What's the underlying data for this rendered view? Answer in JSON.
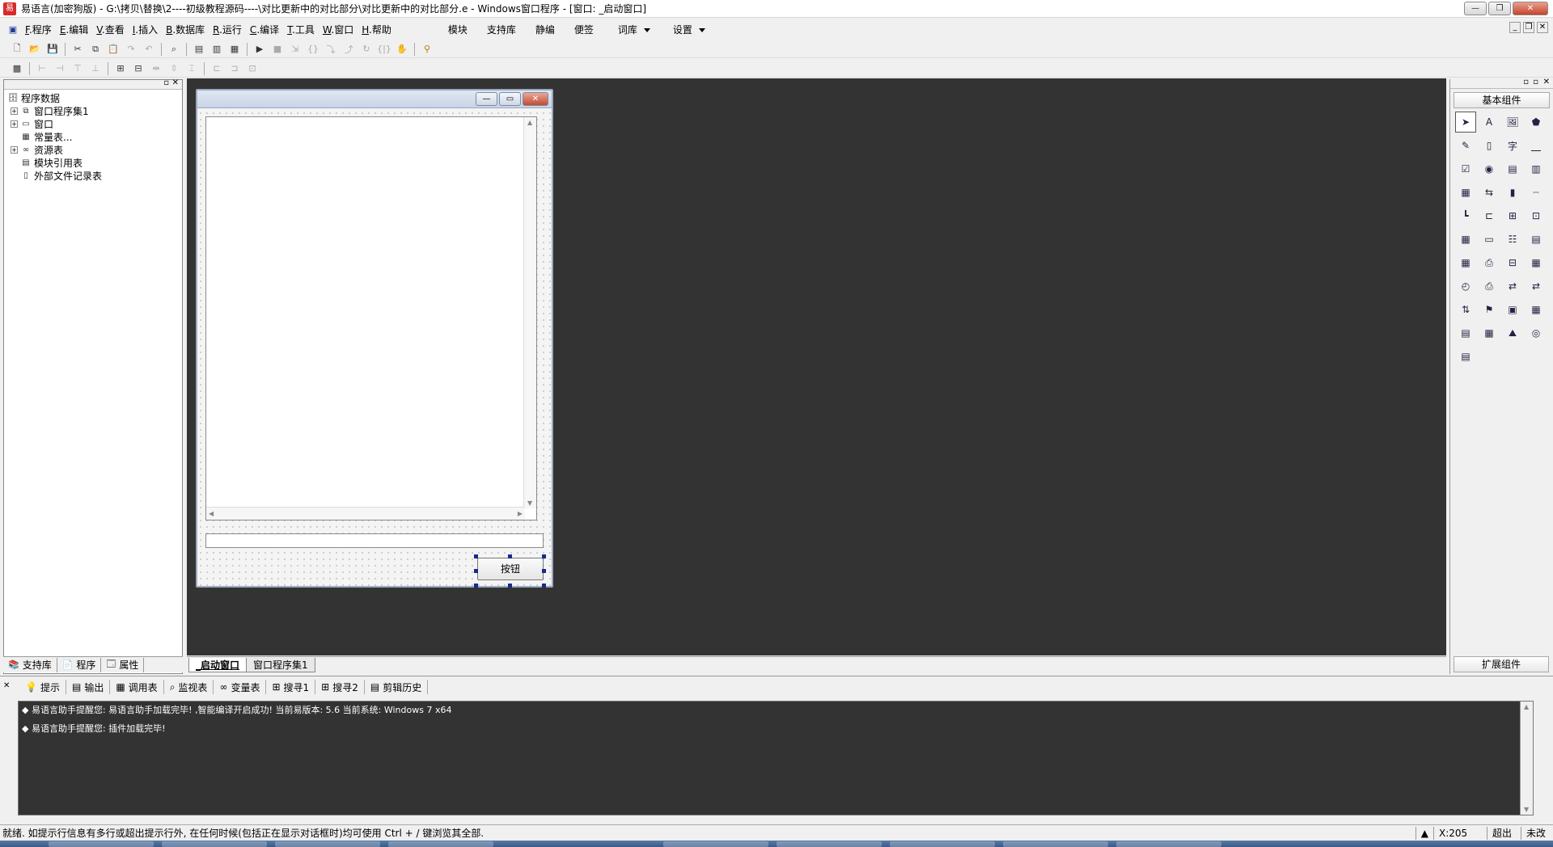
{
  "title_bar": {
    "title": "易语言(加密狗版) - G:\\拷贝\\替换\\2----初级教程源码----\\对比更新中的对比部分\\对比更新中的对比部分.e - Windows窗口程序 - [窗口: _启动窗口]",
    "minimize": "—",
    "maximize": "❐",
    "close": "✕"
  },
  "menu": {
    "items": [
      {
        "key": "F",
        "label": ".程序"
      },
      {
        "key": "E",
        "label": ".编辑"
      },
      {
        "key": "V",
        "label": ".查看"
      },
      {
        "key": "I",
        "label": ".插入"
      },
      {
        "key": "B",
        "label": ".数据库"
      },
      {
        "key": "R",
        "label": ".运行"
      },
      {
        "key": "C",
        "label": ".编译"
      },
      {
        "key": "T",
        "label": ".工具"
      },
      {
        "key": "W",
        "label": ".窗口"
      },
      {
        "key": "H",
        "label": ".帮助"
      }
    ],
    "extras": [
      "模块",
      "支持库",
      "静编",
      "便签"
    ],
    "dropdowns": [
      "词库",
      "设置"
    ]
  },
  "left_panel": {
    "tree": [
      {
        "label": "程序数据",
        "level": 0,
        "expander": "",
        "icon": "db-icon"
      },
      {
        "label": "窗口程序集1",
        "level": 1,
        "expander": "+",
        "icon": "assembly-icon"
      },
      {
        "label": "窗口",
        "level": 1,
        "expander": "+",
        "icon": "window-icon"
      },
      {
        "label": "常量表...",
        "level": 1,
        "expander": "",
        "icon": "constant-icon"
      },
      {
        "label": "资源表",
        "level": 1,
        "expander": "+",
        "icon": "resource-icon"
      },
      {
        "label": "模块引用表",
        "level": 1,
        "expander": "",
        "icon": "module-icon"
      },
      {
        "label": "外部文件记录表",
        "level": 1,
        "expander": "",
        "icon": "file-icon"
      }
    ],
    "tabs": [
      "支持库",
      "程序",
      "属性"
    ]
  },
  "doc_tabs": [
    "_启动窗口",
    "窗口程序集1"
  ],
  "form": {
    "button_label": "按钮"
  },
  "right_panel": {
    "top_title": "基本组件",
    "bottom_title": "扩展组件"
  },
  "output": {
    "tabs": [
      {
        "label": "提示",
        "icon": "hint-icon"
      },
      {
        "label": "输出",
        "icon": "output-icon"
      },
      {
        "label": "调用表",
        "icon": "callstack-icon"
      },
      {
        "label": "监视表",
        "icon": "watch-icon"
      },
      {
        "label": "变量表",
        "icon": "variable-icon"
      },
      {
        "label": "搜寻1",
        "icon": "search1-icon"
      },
      {
        "label": "搜寻2",
        "icon": "search2-icon"
      },
      {
        "label": "剪辑历史",
        "icon": "clip-history-icon"
      }
    ],
    "lines": [
      "◆ 易语言助手提醒您: 易语言助手加载完毕! ,智能编译开启成功! 当前易版本: 5.6 当前系统: Windows 7 x64",
      "◆ 易语言助手提醒您: 插件加载完毕!"
    ]
  },
  "status": {
    "text": "就绪. 如提示行信息有多行或超出提示行外, 在任何时候(包括正在显示对话框时)均可使用 Ctrl + / 键浏览其全部.",
    "coord": "X:205",
    "overwrite": "超出",
    "extra": "未改"
  }
}
